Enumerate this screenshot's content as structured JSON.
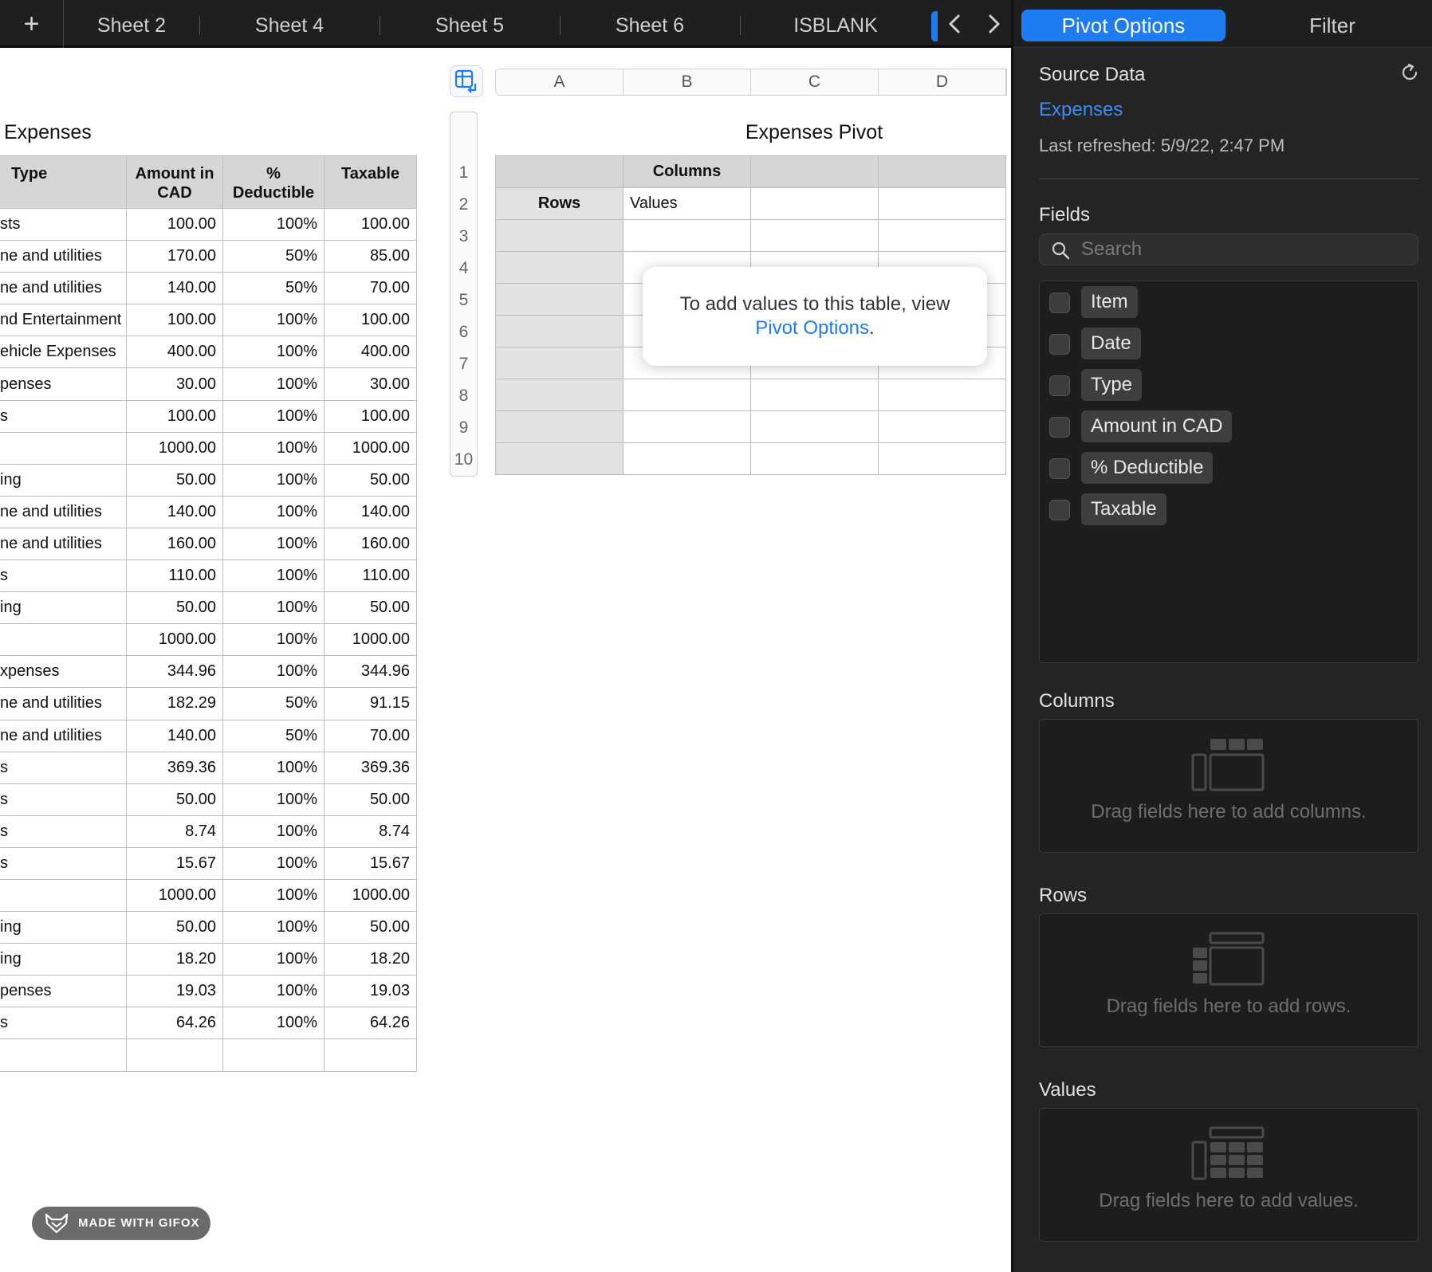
{
  "tabs": {
    "add_label": "+",
    "items": [
      "Sheet 2",
      "Sheet 4",
      "Sheet 5",
      "Sheet 6",
      "ISBLANK"
    ]
  },
  "expenses": {
    "title": "Expenses",
    "headers": {
      "type": "Type",
      "amount_line1": "Amount in",
      "amount_line2": "CAD",
      "deductible_line1": "%",
      "deductible_line2": "Deductible",
      "taxable": "Taxable"
    },
    "rows": [
      [
        "sts",
        "100.00",
        "100%",
        "100.00"
      ],
      [
        "ne and utilities",
        "170.00",
        "50%",
        "85.00"
      ],
      [
        "ne and utilities",
        "140.00",
        "50%",
        "70.00"
      ],
      [
        "nd Entertainment",
        "100.00",
        "100%",
        "100.00"
      ],
      [
        "ehicle Expenses",
        "400.00",
        "100%",
        "400.00"
      ],
      [
        "penses",
        "30.00",
        "100%",
        "30.00"
      ],
      [
        "s",
        "100.00",
        "100%",
        "100.00"
      ],
      [
        "",
        "1000.00",
        "100%",
        "1000.00"
      ],
      [
        "ing",
        "50.00",
        "100%",
        "50.00"
      ],
      [
        "ne and utilities",
        "140.00",
        "100%",
        "140.00"
      ],
      [
        "ne and utilities",
        "160.00",
        "100%",
        "160.00"
      ],
      [
        "s",
        "110.00",
        "100%",
        "110.00"
      ],
      [
        "ing",
        "50.00",
        "100%",
        "50.00"
      ],
      [
        "",
        "1000.00",
        "100%",
        "1000.00"
      ],
      [
        "xpenses",
        "344.96",
        "100%",
        "344.96"
      ],
      [
        "ne and utilities",
        "182.29",
        "50%",
        "91.15"
      ],
      [
        "ne and utilities",
        "140.00",
        "50%",
        "70.00"
      ],
      [
        "s",
        "369.36",
        "100%",
        "369.36"
      ],
      [
        "s",
        "50.00",
        "100%",
        "50.00"
      ],
      [
        "s",
        "8.74",
        "100%",
        "8.74"
      ],
      [
        "s",
        "15.67",
        "100%",
        "15.67"
      ],
      [
        "",
        "1000.00",
        "100%",
        "1000.00"
      ],
      [
        "ing",
        "50.00",
        "100%",
        "50.00"
      ],
      [
        "ing",
        "18.20",
        "100%",
        "18.20"
      ],
      [
        "penses",
        "19.03",
        "100%",
        "19.03"
      ],
      [
        "s",
        "64.26",
        "100%",
        "64.26"
      ],
      [
        "",
        "",
        "",
        ""
      ]
    ]
  },
  "pivot": {
    "title": "Expenses Pivot",
    "column_letters": [
      "A",
      "B",
      "C",
      "D"
    ],
    "row_numbers": [
      "1",
      "2",
      "3",
      "4",
      "5",
      "6",
      "7",
      "8",
      "9",
      "10"
    ],
    "columns_label": "Columns",
    "rows_label": "Rows",
    "values_label": "Values",
    "tooltip_text": "To add values to this table, view",
    "tooltip_link": "Pivot Options",
    "tooltip_end": "."
  },
  "badge": {
    "text": "MADE WITH GIFOX"
  },
  "inspector": {
    "tab_pivot": "Pivot Options",
    "tab_filter": "Filter",
    "source_label": "Source Data",
    "source_name": "Expenses",
    "last_refreshed": "Last refreshed: 5/9/22, 2:47 PM",
    "fields_label": "Fields",
    "search_placeholder": "Search",
    "fields": [
      "Item",
      "Date",
      "Type",
      "Amount in CAD",
      "% Deductible",
      "Taxable"
    ],
    "columns_label": "Columns",
    "columns_hint": "Drag fields here to add columns.",
    "rows_label": "Rows",
    "rows_hint": "Drag fields here to add rows.",
    "values_label": "Values",
    "values_hint": "Drag fields here to add values.",
    "accent_color": "#1d7cf2"
  }
}
